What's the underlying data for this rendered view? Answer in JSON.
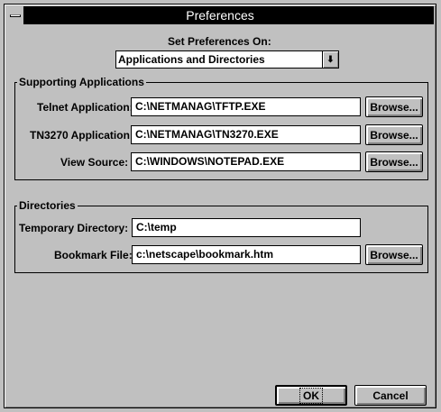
{
  "window": {
    "title": "Preferences"
  },
  "set_prefs": {
    "label": "Set Preferences On:",
    "selected": "Applications and Directories",
    "arrow": "⬇"
  },
  "supporting": {
    "title": "Supporting Applications",
    "rows": [
      {
        "label": "Telnet Application:",
        "value": "C:\\NETMANAG\\TFTP.EXE",
        "browse": "Browse..."
      },
      {
        "label": "TN3270 Application:",
        "value": "C:\\NETMANAG\\TN3270.EXE",
        "browse": "Browse..."
      },
      {
        "label": "View Source:",
        "value": "C:\\WINDOWS\\NOTEPAD.EXE",
        "browse": "Browse..."
      }
    ]
  },
  "directories": {
    "title": "Directories",
    "temp_label": "Temporary Directory:",
    "temp_value": "C:\\temp",
    "bookmark_label": "Bookmark File:",
    "bookmark_value": "c:\\netscape\\bookmark.htm",
    "bookmark_browse": "Browse..."
  },
  "buttons": {
    "ok": "OK",
    "cancel": "Cancel"
  }
}
